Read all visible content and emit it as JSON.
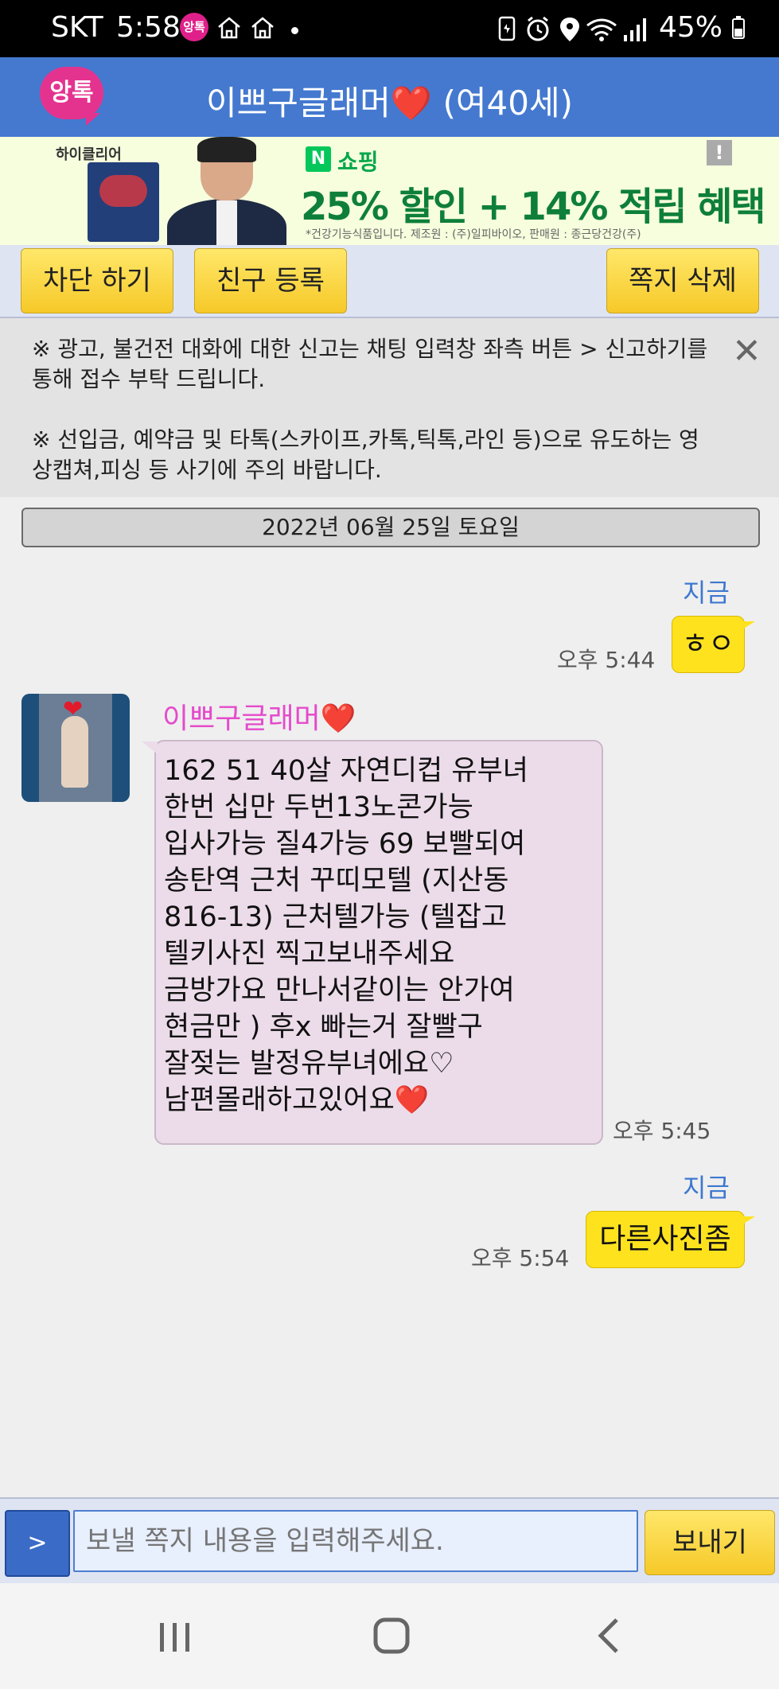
{
  "status_bar": {
    "carrier": "SKT",
    "time": "5:58",
    "notification_app": "앙톡",
    "battery": "45%",
    "icons": [
      "home-icon",
      "home-icon",
      "dot-icon",
      "battery-saver-icon",
      "alarm-icon",
      "location-icon",
      "wifi-icon",
      "signal-icon",
      "battery-icon"
    ]
  },
  "header": {
    "logo": "앙톡",
    "title_name": "이쁘구글래머",
    "title_heart": "❤️",
    "title_info": " (여40세)"
  },
  "ad": {
    "brand": "하이클리어",
    "shop_badge": "N",
    "shop_label": "쇼핑",
    "promo": "25% 할인 + 14% 적립 혜택",
    "fine_print": "*건강기능식품입니다. 제조원 : (주)일피바이오, 판매원 : 종근당건강(주)",
    "info_badge": "!"
  },
  "toolbar": {
    "block_label": "차단 하기",
    "friend_label": "친구 등록",
    "delete_label": "쪽지 삭제"
  },
  "notice": {
    "line1": "※ 광고, 불건전 대화에 대한 신고는 채팅 입력창 좌측 버튼 > 신고하기를 통해 접수 부탁 드립니다.",
    "line2": "※ 선입금, 예약금 및 타톡(스카이프,카톡,틱톡,라인 등)으로 유도하는 영상캡쳐,피싱 등 사기에 주의 바랍니다.",
    "close_glyph": "✕"
  },
  "date_divider": "2022년 06월 25일 토요일",
  "messages": [
    {
      "from": "me",
      "read": "지금",
      "time": "오후 5:44",
      "text": "ㅎㅇ"
    },
    {
      "from": "them",
      "sender": "이쁘구글래머",
      "sender_heart": "❤️",
      "time": "오후 5:45",
      "text": "162 51 40살 자연디컵 유부녀\n한번 십만 두번13노콘가능\n입사가능 질4가능 69 보빨되여\n송탄역 근처 꾸띠모텔 (지산동\n816-13)   근처텔가능 (텔잡고\n텔키사진 찍고보내주세요\n금방가요 만나서같이는 안가여\n현금만 ) 후x   빠는거 잘빨구\n잘젖는 발정유부녀에요♡\n남편몰래하고있어요❤️"
    },
    {
      "from": "me",
      "read": "지금",
      "time": "오후 5:54",
      "text": "다른사진좀"
    }
  ],
  "input_bar": {
    "report_label": ">",
    "placeholder": "보낼 쪽지 내용을 입력해주세요.",
    "send_label": "보내기"
  },
  "nav_bar": {
    "recents": "recents-icon",
    "home": "home-icon",
    "back": "back-icon"
  }
}
